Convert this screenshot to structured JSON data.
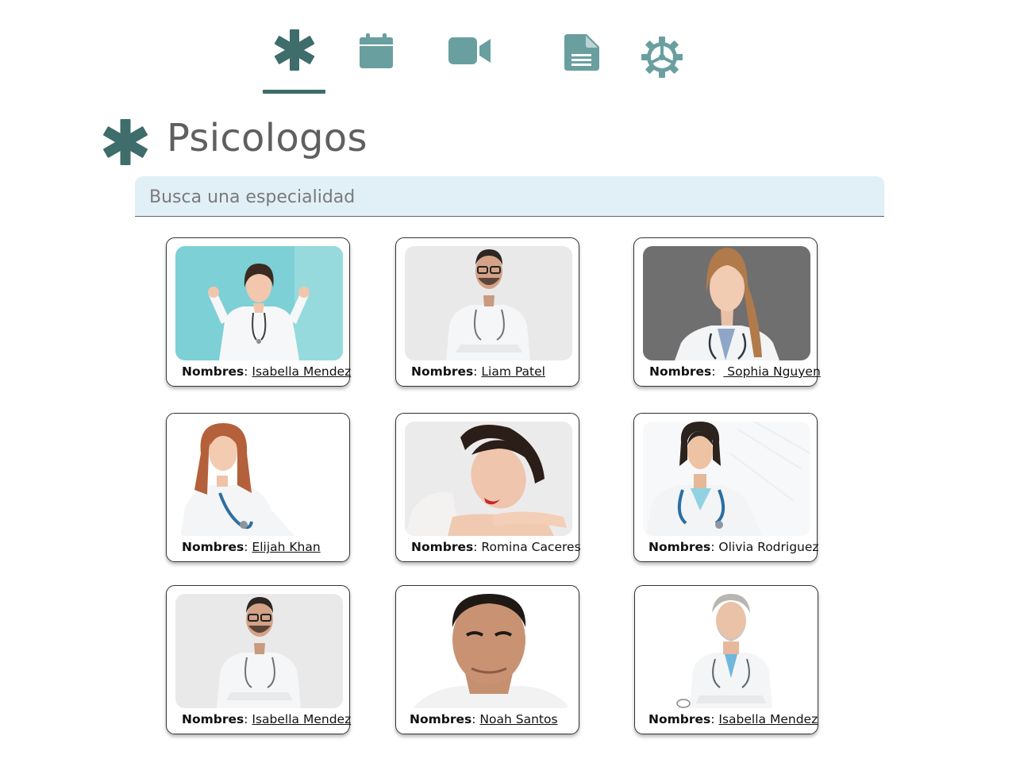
{
  "nav": {
    "items": [
      {
        "id": "specialties",
        "icon": "asterisk-icon",
        "active": true
      },
      {
        "id": "calendar",
        "icon": "calendar-icon",
        "active": false
      },
      {
        "id": "video",
        "icon": "video-camera-icon",
        "active": false
      },
      {
        "id": "documents",
        "icon": "document-icon",
        "active": false
      },
      {
        "id": "settings",
        "icon": "gear-icon",
        "active": false
      }
    ]
  },
  "colors": {
    "accent_dark": "#3f6d6b",
    "icon_teal": "#6a9fa0",
    "search_bg": "#e1f0f6",
    "title_text": "#5f5f5f"
  },
  "page": {
    "title": "Psicologos",
    "title_icon": "asterisk-icon"
  },
  "search": {
    "placeholder": "Busca una especialidad",
    "value": ""
  },
  "cards": [
    {
      "label": "Nombres",
      "sep": ": ",
      "name": "Isabella Mendez",
      "linked": true
    },
    {
      "label": "Nombres",
      "sep": ": ",
      "name": "Liam Patel",
      "linked": true
    },
    {
      "label": "Nombres",
      "sep": ":  ",
      "name": " Sophia Nguyen",
      "linked": true
    },
    {
      "label": "Nombres",
      "sep": ": ",
      "name": "Elijah Khan",
      "linked": true
    },
    {
      "label": "Nombres",
      "sep": ": ",
      "name": "Romina Caceres",
      "linked": false
    },
    {
      "label": "Nombres",
      "sep": ": ",
      "name": "Olivia Rodriguez",
      "linked": false
    },
    {
      "label": "Nombres",
      "sep": ": ",
      "name": "Isabella Mendez",
      "linked": true
    },
    {
      "label": "Nombres",
      "sep": ": ",
      "name": "Noah Santos",
      "linked": true
    },
    {
      "label": "Nombres",
      "sep": ": ",
      "name": "Isabella Mendez",
      "linked": true
    }
  ]
}
